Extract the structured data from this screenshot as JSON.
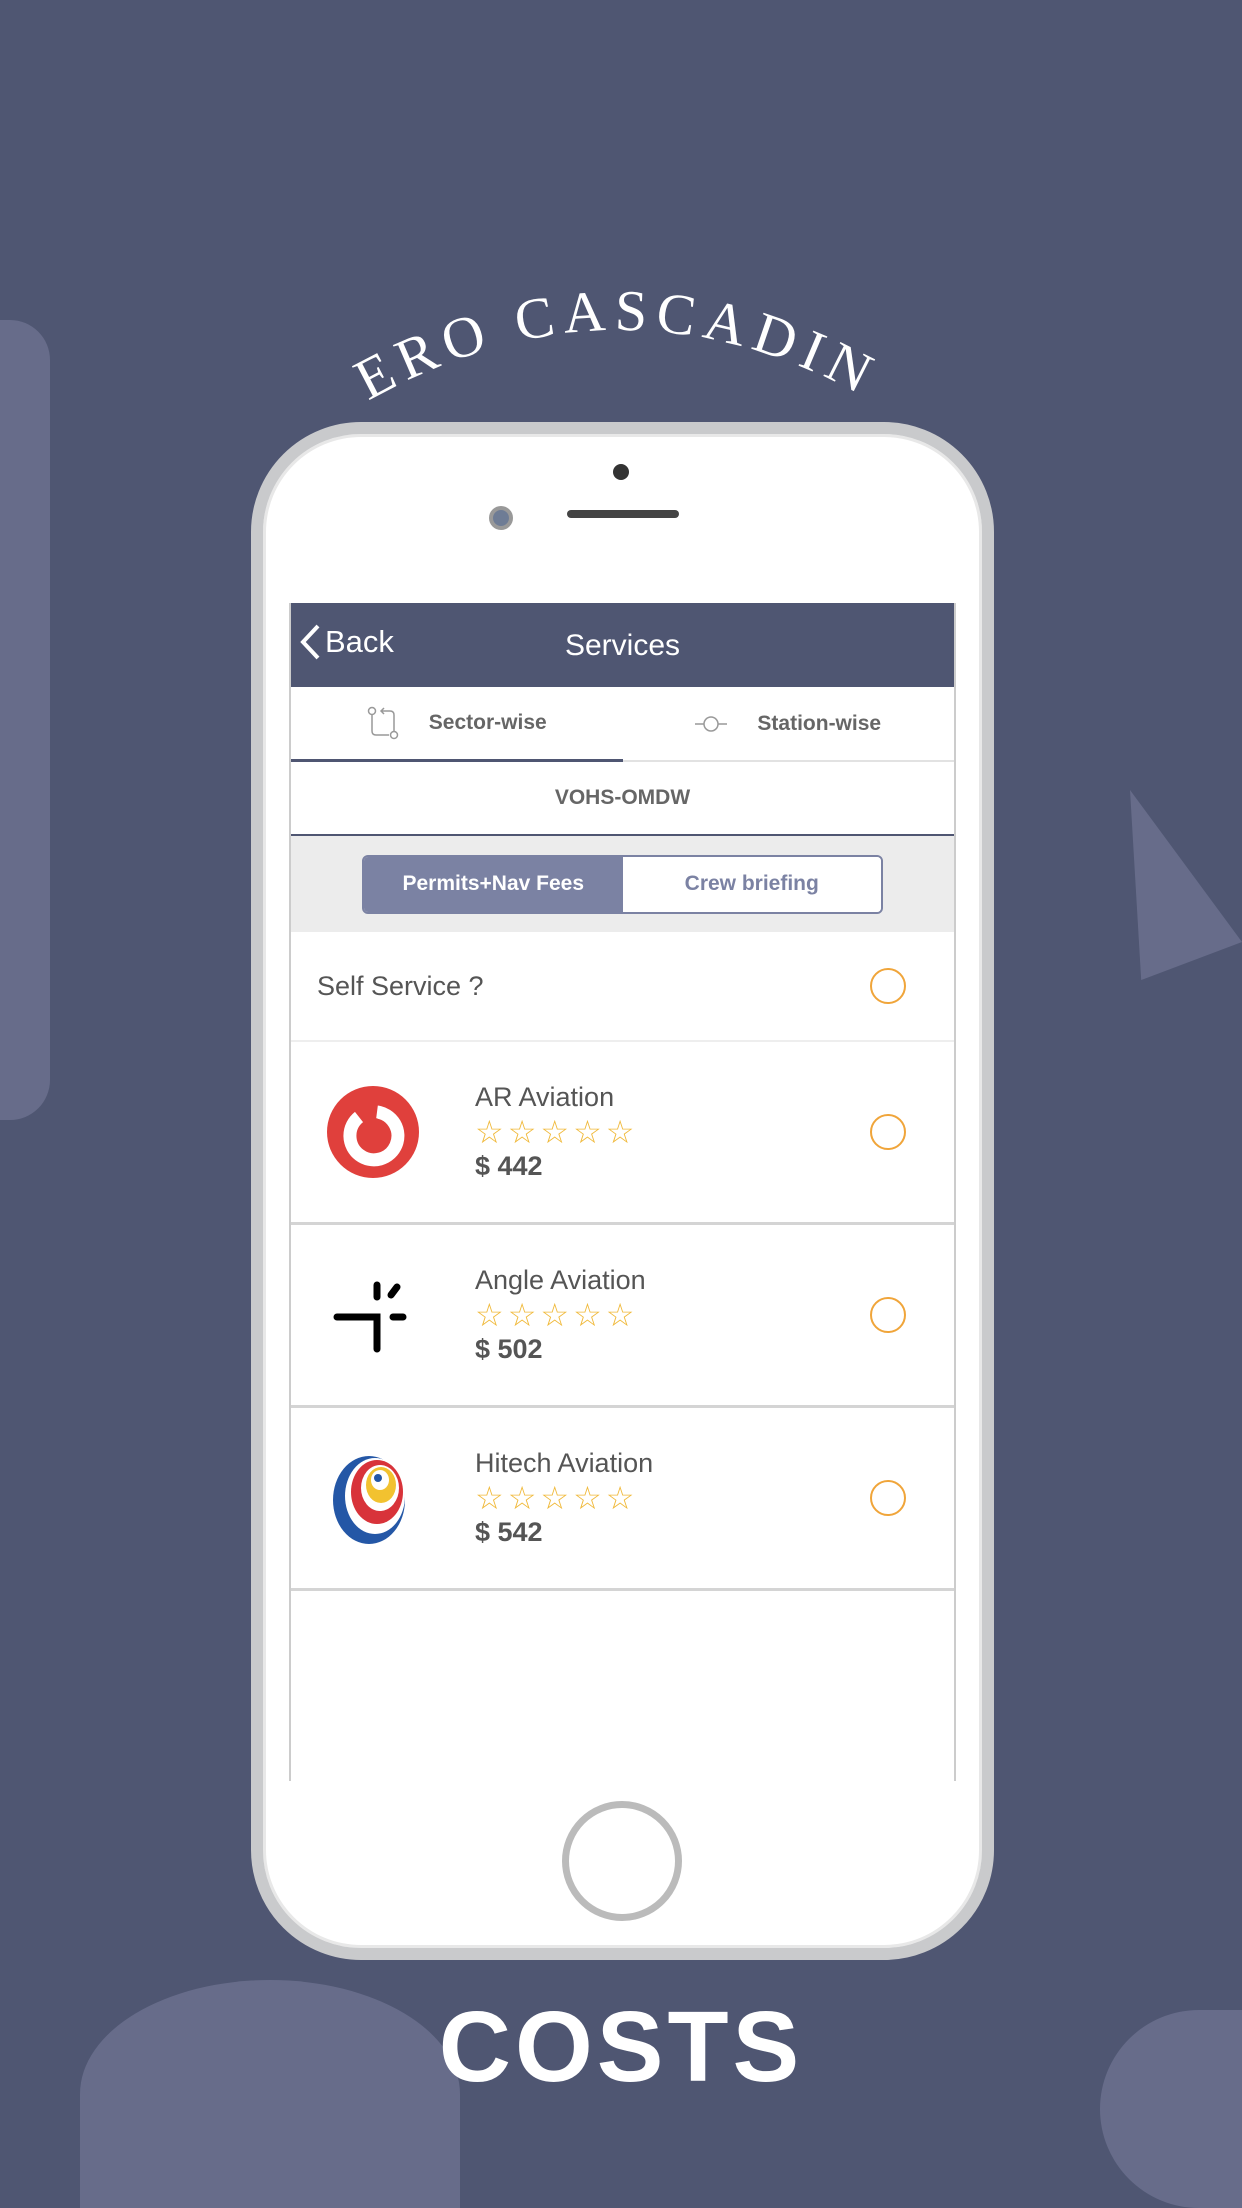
{
  "promo": {
    "headline_top": "- ZERO CASCADING -",
    "headline_bottom": "COSTS"
  },
  "header": {
    "back_label": "Back",
    "title": "Services"
  },
  "tabs": [
    {
      "label": "Sector-wise",
      "icon": "route-icon",
      "active": true
    },
    {
      "label": "Station-wise",
      "icon": "station-icon",
      "active": false
    }
  ],
  "route": "VOHS-OMDW",
  "segments": [
    {
      "label": "Permits+Nav Fees",
      "selected": true
    },
    {
      "label": "Crew briefing",
      "selected": false
    }
  ],
  "self_service": {
    "label": "Self Service ?",
    "selected": false
  },
  "providers": [
    {
      "name": "AR Aviation",
      "rating": 0,
      "stars": "☆☆☆☆☆",
      "price": "$ 442",
      "logo": "ar-aviation-logo"
    },
    {
      "name": "Angle Aviation",
      "rating": 0,
      "stars": "☆☆☆☆☆",
      "price": "$ 502",
      "logo": "angle-aviation-logo"
    },
    {
      "name": "Hitech Aviation",
      "rating": 0,
      "stars": "☆☆☆☆☆",
      "price": "$ 542",
      "logo": "hitech-aviation-logo"
    }
  ],
  "colors": {
    "background": "#4f5672",
    "header": "#4f5672",
    "segment_active": "#7b82a3",
    "radio": "#f0a53a",
    "star": "#f0b93a"
  }
}
